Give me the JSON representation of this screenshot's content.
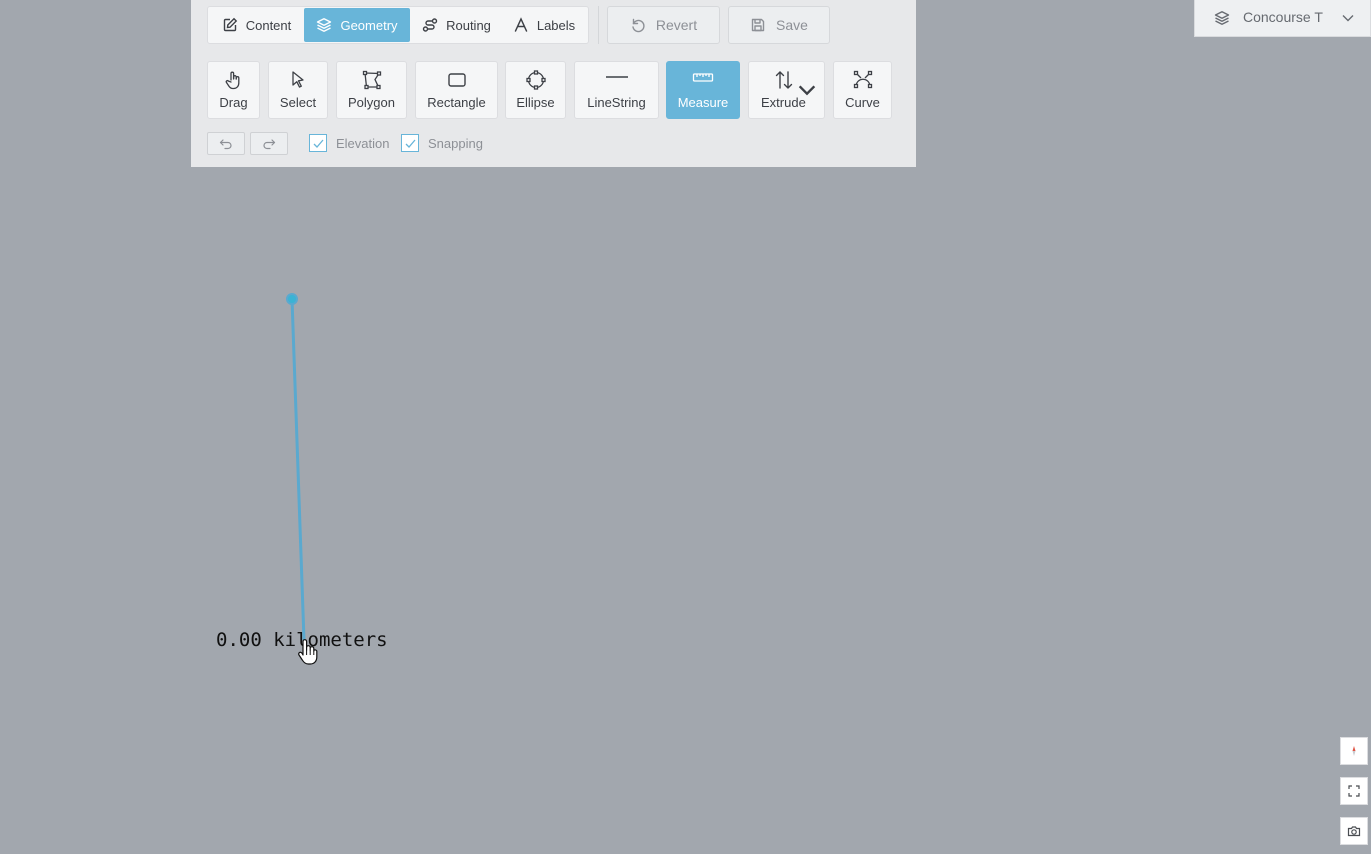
{
  "tabs": {
    "content": "Content",
    "geometry": "Geometry",
    "routing": "Routing",
    "labels": "Labels",
    "active": "Geometry"
  },
  "actions": {
    "revert": "Revert",
    "save": "Save"
  },
  "tools": {
    "drag": "Drag",
    "select": "Select",
    "polygon": "Polygon",
    "rectangle": "Rectangle",
    "ellipse": "Ellipse",
    "linestring": "LineString",
    "measure": "Measure",
    "extrude": "Extrude",
    "curve": "Curve",
    "active": "Measure"
  },
  "options": {
    "elevation": {
      "label": "Elevation",
      "checked": true
    },
    "snapping": {
      "label": "Snapping",
      "checked": true
    }
  },
  "floor_selector": {
    "label": "Concourse T",
    "icon": "layers-icon"
  },
  "measurement": {
    "label": "0.00 kilometers"
  },
  "map_controls": [
    "compass-icon",
    "fullscreen-icon",
    "camera-icon"
  ],
  "colors": {
    "map_background": "#a2a7ae",
    "accent": "#68b5d9",
    "measure_line": "#5aa9cf",
    "compass_needle": "#e05545"
  }
}
